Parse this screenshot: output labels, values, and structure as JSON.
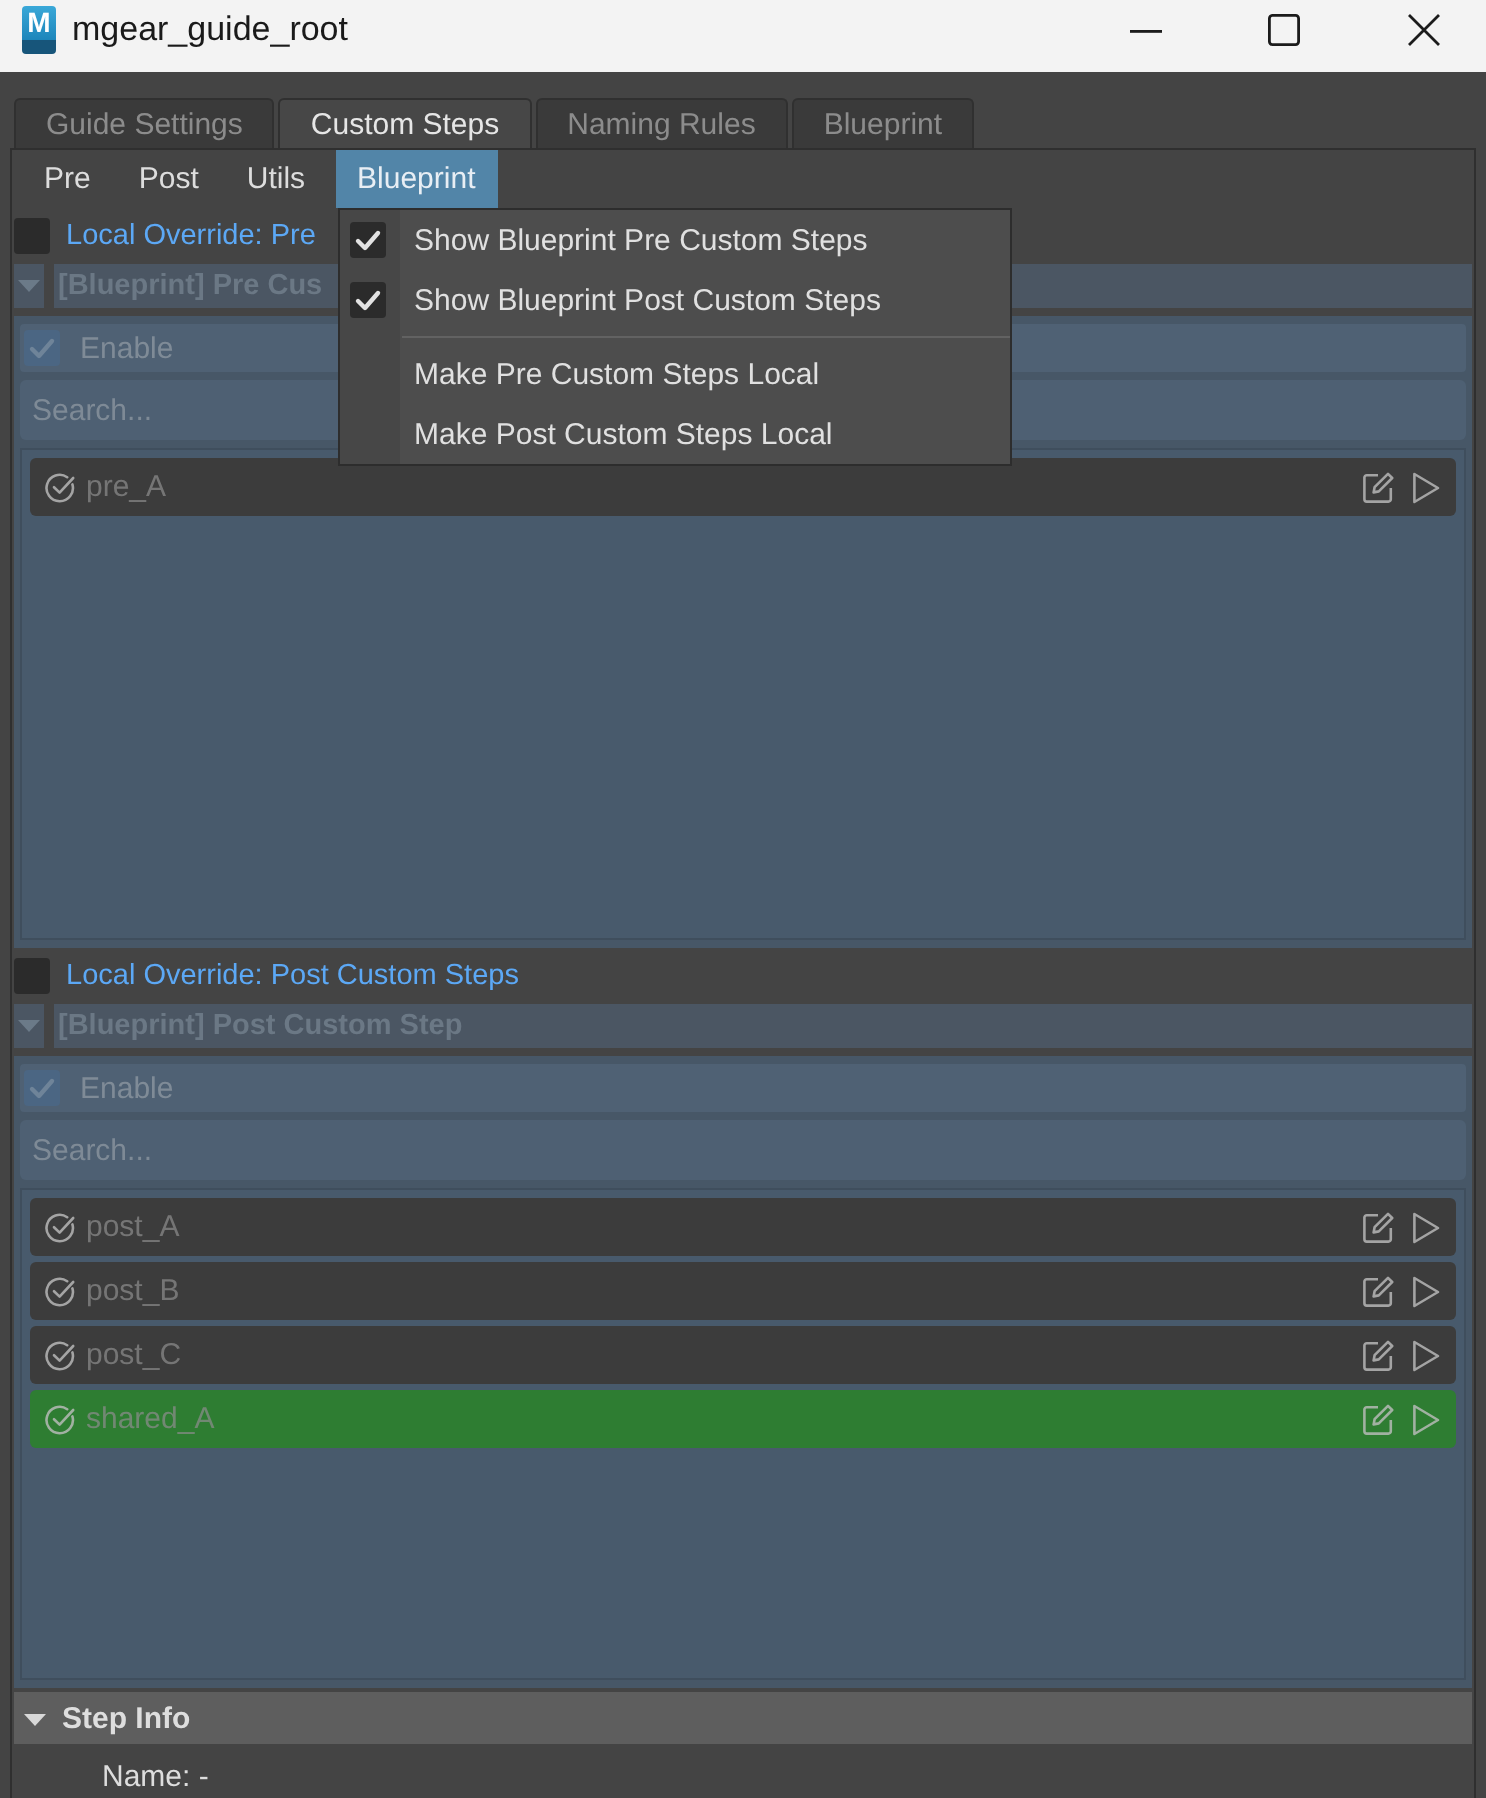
{
  "window": {
    "icon_letter": "M",
    "title": "mgear_guide_root"
  },
  "tabs": [
    {
      "label": "Guide Settings",
      "selected": false
    },
    {
      "label": "Custom Steps",
      "selected": true
    },
    {
      "label": "Naming Rules",
      "selected": false
    },
    {
      "label": "Blueprint",
      "selected": false
    }
  ],
  "menu_bar": [
    {
      "label": "Pre",
      "selected": false
    },
    {
      "label": "Post",
      "selected": false
    },
    {
      "label": "Utils",
      "selected": false
    },
    {
      "label": "Blueprint",
      "selected": true
    }
  ],
  "sections": [
    {
      "override": {
        "label": "Local Override: Pre",
        "checked": false
      },
      "header": {
        "label": "[Blueprint] Pre Cus",
        "expanded": true
      },
      "enable": {
        "label": "Enable",
        "checked": true,
        "disabled": true
      },
      "search": {
        "placeholder": "Search..."
      },
      "steps": [
        {
          "name": "pre_A",
          "color": "#3c3c3c"
        }
      ]
    },
    {
      "override": {
        "label": "Local Override: Post Custom Steps",
        "checked": false
      },
      "header": {
        "label": "[Blueprint] Post Custom Step",
        "expanded": true
      },
      "enable": {
        "label": "Enable",
        "checked": true,
        "disabled": true
      },
      "search": {
        "placeholder": "Search..."
      },
      "steps": [
        {
          "name": "post_A",
          "color": "#3c3c3c"
        },
        {
          "name": "post_B",
          "color": "#3c3c3c"
        },
        {
          "name": "post_C",
          "color": "#3c3c3c"
        },
        {
          "name": "shared_A",
          "color": "#2e7d32"
        }
      ]
    }
  ],
  "step_info": {
    "label": "Step Info",
    "expanded": true,
    "lines": [
      "Name: -"
    ]
  },
  "open_menu": {
    "groups": [
      {
        "items": [
          {
            "kind": "check",
            "label": "Show Blueprint Pre Custom Steps",
            "checked": true
          },
          {
            "kind": "check",
            "label": "Show Blueprint Post Custom Steps",
            "checked": true
          }
        ]
      },
      {
        "items": [
          {
            "kind": "action",
            "label": "Make Pre Custom Steps Local"
          },
          {
            "kind": "action",
            "label": "Make Post Custom Steps Local"
          }
        ]
      }
    ]
  }
}
